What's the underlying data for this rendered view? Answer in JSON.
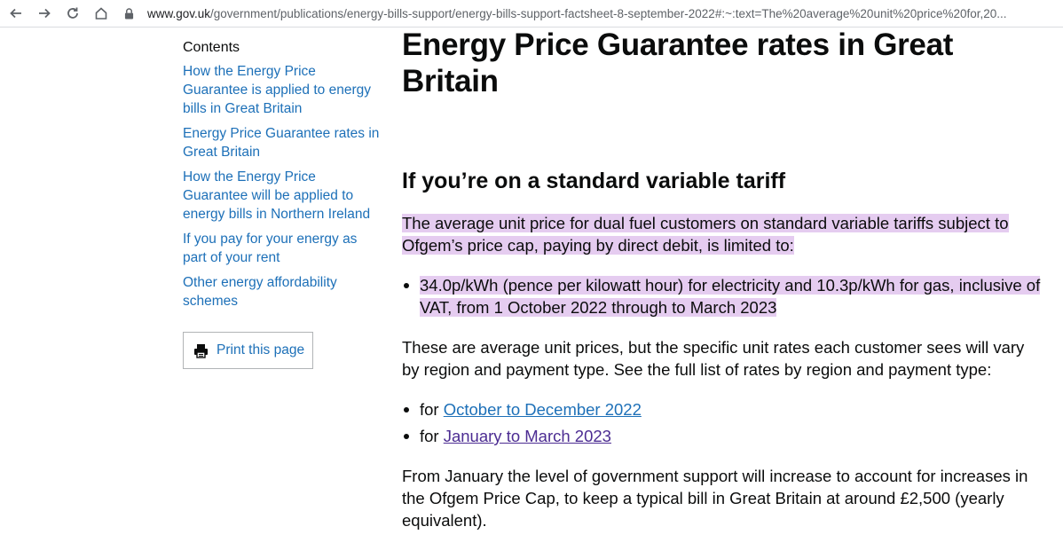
{
  "browser": {
    "url_host": "www.gov.uk",
    "url_path": "/government/publications/energy-bills-support/energy-bills-support-factsheet-8-september-2022#:~:text=The%20average%20unit%20price%20for,20..."
  },
  "sidebar": {
    "contents_title": "Contents",
    "items": [
      {
        "label": "How the Energy Price Guarantee is applied to energy bills in Great Britain"
      },
      {
        "label": "Energy Price Guarantee rates in Great Britain"
      },
      {
        "label": "How the Energy Price Guarantee will be applied to energy bills in Northern Ireland"
      },
      {
        "label": "If you pay for your energy as part of your rent"
      },
      {
        "label": "Other energy affordability schemes"
      }
    ],
    "print_label": "Print this page"
  },
  "main": {
    "title": "Energy Price Guarantee rates in Great Britain",
    "subheading": "If you’re on a standard variable tariff",
    "para1": "The average unit price for dual fuel customers on standard variable tariffs subject to Ofgem’s price cap, paying by direct debit, is limited to:",
    "bullet1": "34.0p/kWh (pence per kilowatt hour) for electricity and 10.3p/kWh for gas, inclusive of VAT, from 1 October 2022 through to March 2023",
    "para2": "These are average unit prices, but the specific unit rates each customer sees will vary by region and payment type. See the full list of rates by region and payment type:",
    "rate_links": [
      {
        "prefix": "for ",
        "label": "October to December 2022"
      },
      {
        "prefix": "for ",
        "label": "January to March 2023"
      }
    ],
    "para3": "From January the level of government support will increase to account for increases in the Ofgem Price Cap, to keep a typical bill in Great Britain at around £2,500 (yearly equivalent)."
  },
  "colors": {
    "link": "#1d70b8",
    "visited_link": "#4c2c92",
    "highlight": "#e5ccf0",
    "text": "#0b0c0c"
  }
}
